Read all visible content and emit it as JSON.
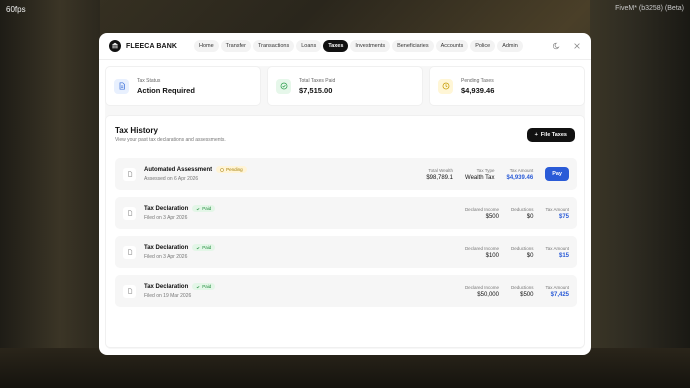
{
  "overlay": {
    "fps": "60fps",
    "build": "FiveM* (b3258) (Beta)"
  },
  "brand": {
    "name": "FLEECA BANK"
  },
  "nav": [
    "Home",
    "Transfer",
    "Transactions",
    "Loans",
    "Taxes",
    "Investments",
    "Beneficiaries",
    "Accounts",
    "Police",
    "Admin"
  ],
  "nav_active": "Taxes",
  "cards": [
    {
      "label": "Tax Status",
      "value": "Action Required",
      "icon": "document-icon",
      "color": "#e8f0fe"
    },
    {
      "label": "Total Taxes Paid",
      "value": "$7,515.00",
      "icon": "check-circle-icon",
      "color": "#e6f7ea"
    },
    {
      "label": "Pending Taxes",
      "value": "$4,939.46",
      "icon": "clock-icon",
      "color": "#fff6d6"
    }
  ],
  "history": {
    "title": "Tax History",
    "subtitle": "View your past tax declarations and assessments.",
    "file_button": "File Taxes",
    "rows": [
      {
        "title": "Automated Assessment",
        "badge": "Pending",
        "badge_type": "pending",
        "date": "Assessed on 6 Apr 2026",
        "metrics": [
          {
            "label": "Total Wealth",
            "value": "$98,789.1"
          },
          {
            "label": "Tax Type",
            "value": "Wealth Tax"
          },
          {
            "label": "Tax Amount",
            "value": "$4,939.46",
            "blue": true
          }
        ],
        "action": "Pay"
      },
      {
        "title": "Tax Declaration",
        "badge": "Paid",
        "badge_type": "paid",
        "date": "Filed on 3 Apr 2026",
        "metrics": [
          {
            "label": "Declared Income",
            "value": "$500"
          },
          {
            "label": "Deductions",
            "value": "$0"
          },
          {
            "label": "Tax Amount",
            "value": "$75",
            "blue": true
          }
        ]
      },
      {
        "title": "Tax Declaration",
        "badge": "Paid",
        "badge_type": "paid",
        "date": "Filed on 3 Apr 2026",
        "metrics": [
          {
            "label": "Declared Income",
            "value": "$100"
          },
          {
            "label": "Deductions",
            "value": "$0"
          },
          {
            "label": "Tax Amount",
            "value": "$15",
            "blue": true
          }
        ]
      },
      {
        "title": "Tax Declaration",
        "badge": "Paid",
        "badge_type": "paid",
        "date": "Filed on 19 Mar 2026",
        "metrics": [
          {
            "label": "Declared Income",
            "value": "$50,000"
          },
          {
            "label": "Deductions",
            "value": "$500"
          },
          {
            "label": "Tax Amount",
            "value": "$7,425",
            "blue": true
          }
        ]
      }
    ]
  }
}
